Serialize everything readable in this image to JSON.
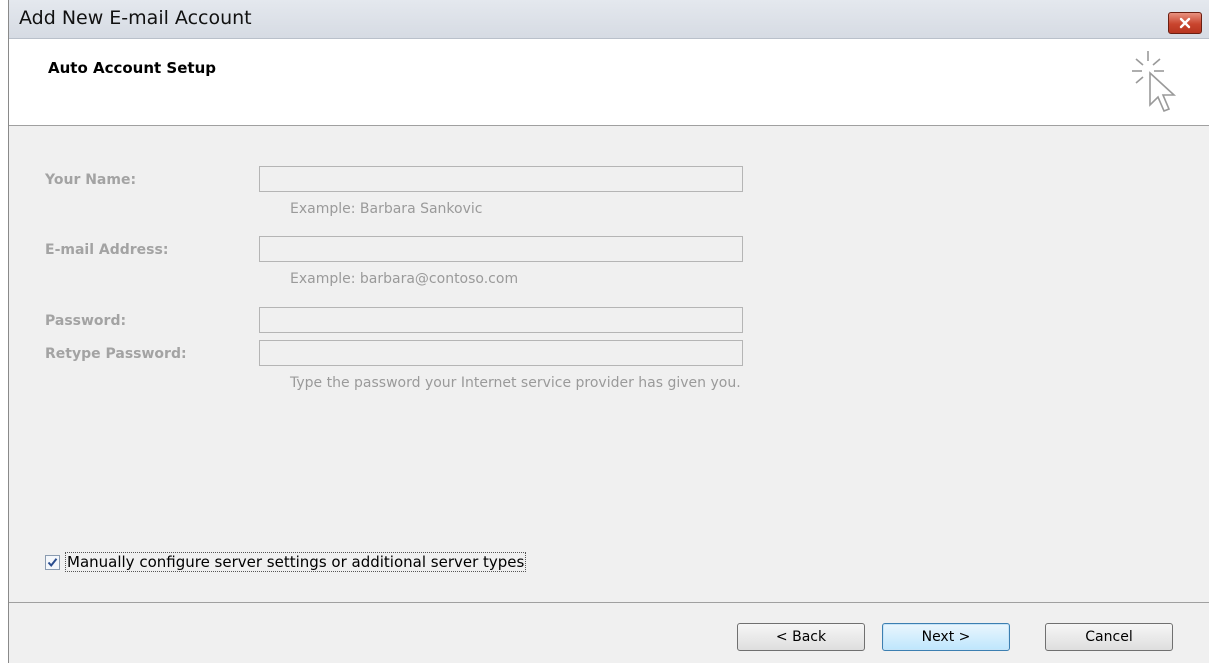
{
  "window": {
    "title": "Add New E-mail Account"
  },
  "header": {
    "title": "Auto Account Setup"
  },
  "form": {
    "name": {
      "label": "Your Name:",
      "value": "",
      "hint": "Example: Barbara Sankovic"
    },
    "email": {
      "label": "E-mail Address:",
      "value": "",
      "hint": "Example: barbara@contoso.com"
    },
    "password": {
      "label": "Password:",
      "value": ""
    },
    "retype_password": {
      "label": "Retype Password:",
      "value": "",
      "hint": "Type the password your Internet service provider has given you."
    }
  },
  "manual_config": {
    "label": "Manually configure server settings or additional server types",
    "checked": true
  },
  "buttons": {
    "back": "< Back",
    "next": "Next >",
    "cancel": "Cancel"
  },
  "icons": {
    "close": "close-icon",
    "cursor": "cursor-sparkle-icon",
    "check": "check-icon"
  },
  "colors": {
    "close_button": "#c9452e",
    "primary_button_border": "#3c7fb1",
    "disabled_text": "#a3a3a3"
  }
}
